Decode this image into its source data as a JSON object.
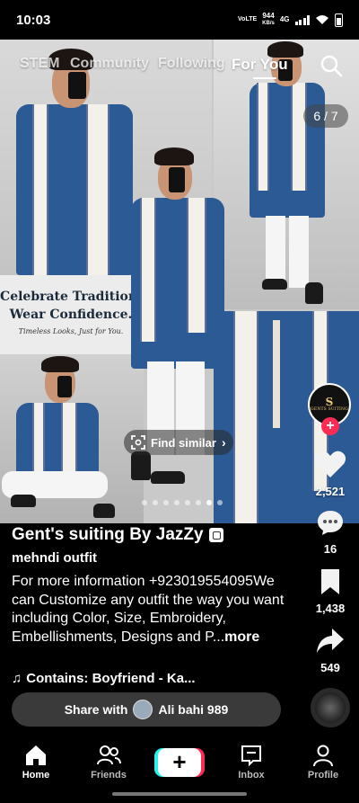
{
  "status_bar": {
    "time": "10:03",
    "network_top": "VoLTE",
    "speed_value": "944",
    "speed_unit": "KB/s",
    "network_type": "4G"
  },
  "top_nav": {
    "tabs": [
      {
        "label": "STEM",
        "active": false
      },
      {
        "label": "Community",
        "active": false
      },
      {
        "label": "Following",
        "active": false
      },
      {
        "label": "For You",
        "active": true
      }
    ],
    "search_icon": "search-icon"
  },
  "media": {
    "counter": "6 / 7",
    "tagline_line1": "Celebrate Tradition,",
    "tagline_line2": "Wear Confidence.",
    "tagline_line3": "Timeless Looks, Just for You.",
    "find_similar_label": "Find similar",
    "dots_total": 8,
    "dots_active_index": 6
  },
  "creator": {
    "avatar_mono": "S",
    "avatar_brand": "GENTS SUITING",
    "follow_label": "+"
  },
  "actions": {
    "likes": "2,521",
    "comments": "16",
    "saves": "1,438",
    "shares": "549"
  },
  "caption": {
    "author": "Gent's suiting By JazZy",
    "subtitle": "mehndi outfit",
    "description": "For more information +923019554095We can Customize any outfit the way you want including Color, Size, Embroidery, Embellishments, Designs and P...",
    "more_label": "more",
    "music": "Contains: Boyfriend - Ka..."
  },
  "share_bar": {
    "prefix": "Share with",
    "name": "Ali bahi 989"
  },
  "bottom_nav": {
    "items": [
      {
        "label": "Home",
        "active": true
      },
      {
        "label": "Friends",
        "active": false
      },
      {
        "label": "",
        "active": false
      },
      {
        "label": "Inbox",
        "active": false
      },
      {
        "label": "Profile",
        "active": false
      }
    ]
  },
  "colors": {
    "accent_red": "#fe2c55",
    "accent_cyan": "#25f4ee",
    "kurta_blue": "#2c5a94"
  }
}
